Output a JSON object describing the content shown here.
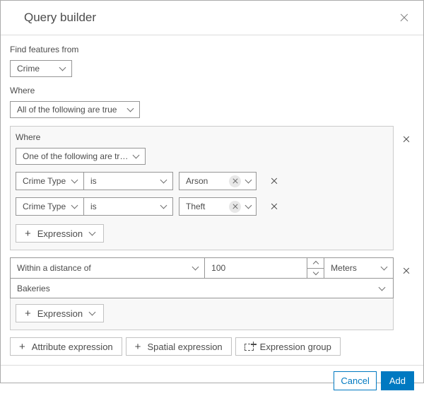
{
  "dialog": {
    "title": "Query builder"
  },
  "icons": {
    "close": "x-shape",
    "dropdown": "chevron-down",
    "remove_row": "x-shape",
    "chip_remove": "x-in-circle",
    "expression_group": "dashed-box-plus"
  },
  "colors": {
    "accent_blue": "#0079c1",
    "group_background": "#f8f8f8",
    "control_border": "#969696",
    "text": "#4c4c4c"
  },
  "find_from": {
    "label": "Find features from",
    "layer_select_value": "Crime"
  },
  "where": {
    "label": "Where",
    "combine_select_value": "All of the following are true"
  },
  "group1": {
    "label": "Where",
    "combine_select_value": "One of the following are tr…",
    "rows": [
      {
        "field": "Crime Type",
        "operator": "is",
        "value": "Arson"
      },
      {
        "field": "Crime Type",
        "operator": "is",
        "value": "Theft"
      }
    ],
    "add_expression": {
      "plus": "+",
      "label": "Expression"
    }
  },
  "group2": {
    "condition_select_value": "Within a distance of",
    "distance_input_value": "100",
    "unit_select_value": "Meters",
    "layer_select_value": "Bakeries",
    "add_expression": {
      "plus": "+",
      "label": "Expression"
    }
  },
  "actions": {
    "attribute_expression": {
      "plus": "+",
      "label": "Attribute expression"
    },
    "spatial_expression": {
      "plus": "+",
      "label": "Spatial expression"
    },
    "expression_group": {
      "label": "Expression group"
    }
  },
  "footer": {
    "cancel_label": "Cancel",
    "add_label": "Add"
  }
}
